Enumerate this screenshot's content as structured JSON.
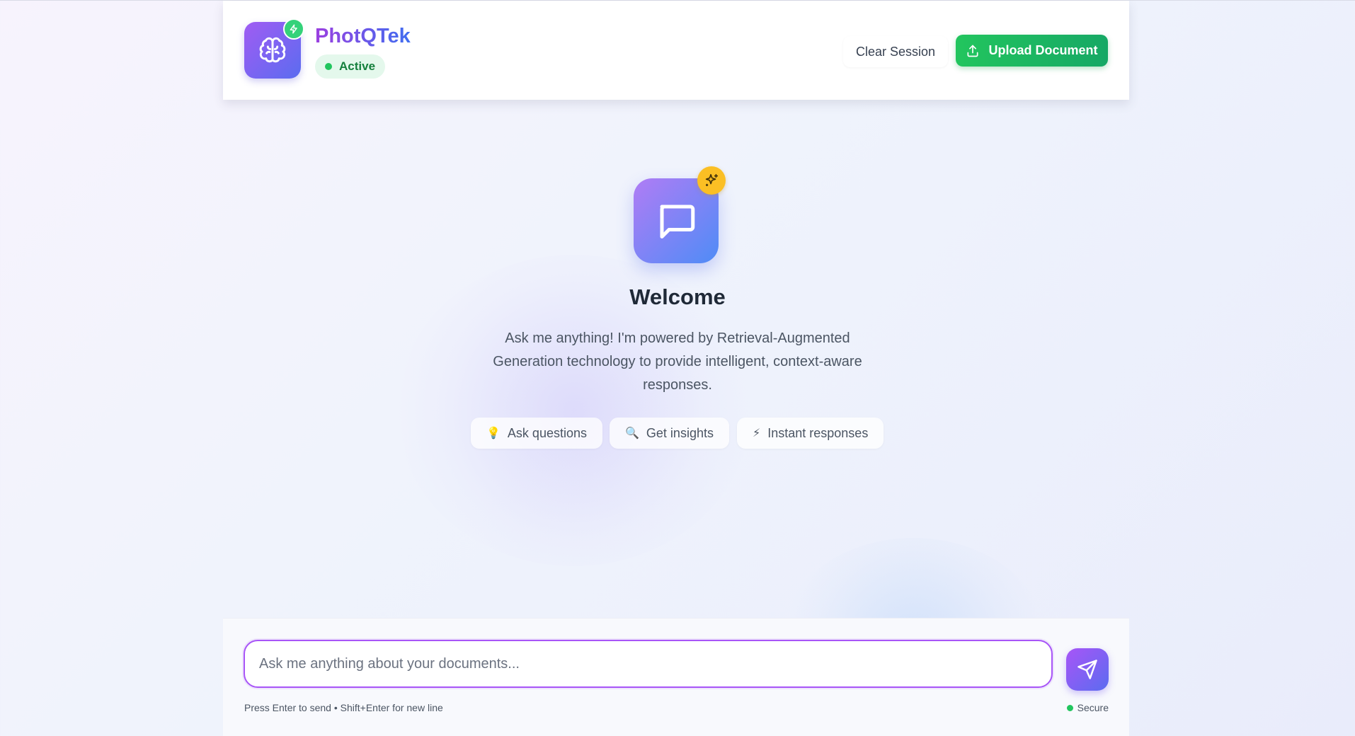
{
  "header": {
    "brand": "PhotQTek",
    "status": "Active",
    "clear_label": "Clear Session",
    "upload_label": "Upload Document",
    "logo_icon": "brain-icon",
    "logo_badge_icon": "lightning-icon"
  },
  "welcome": {
    "icon": "chat-bubble-icon",
    "badge_icon": "sparkles-icon",
    "title": "Welcome",
    "description": "Ask me anything! I'm powered by Retrieval-Augmented Generation technology to provide intelligent, context-aware responses.",
    "chips": [
      {
        "emoji": "💡",
        "label": "Ask questions"
      },
      {
        "emoji": "🔍",
        "label": "Get insights"
      },
      {
        "emoji": "⚡",
        "label": "Instant responses"
      }
    ]
  },
  "composer": {
    "placeholder": "Ask me anything about your documents...",
    "value": "",
    "hint": "Press Enter to send • Shift+Enter for new line",
    "secure_label": "Secure",
    "send_icon": "send-icon"
  },
  "colors": {
    "accent_purple": "#a855f7",
    "accent_blue": "#5b6cf0",
    "success_green": "#22c55e",
    "badge_yellow": "#fbbf24"
  }
}
